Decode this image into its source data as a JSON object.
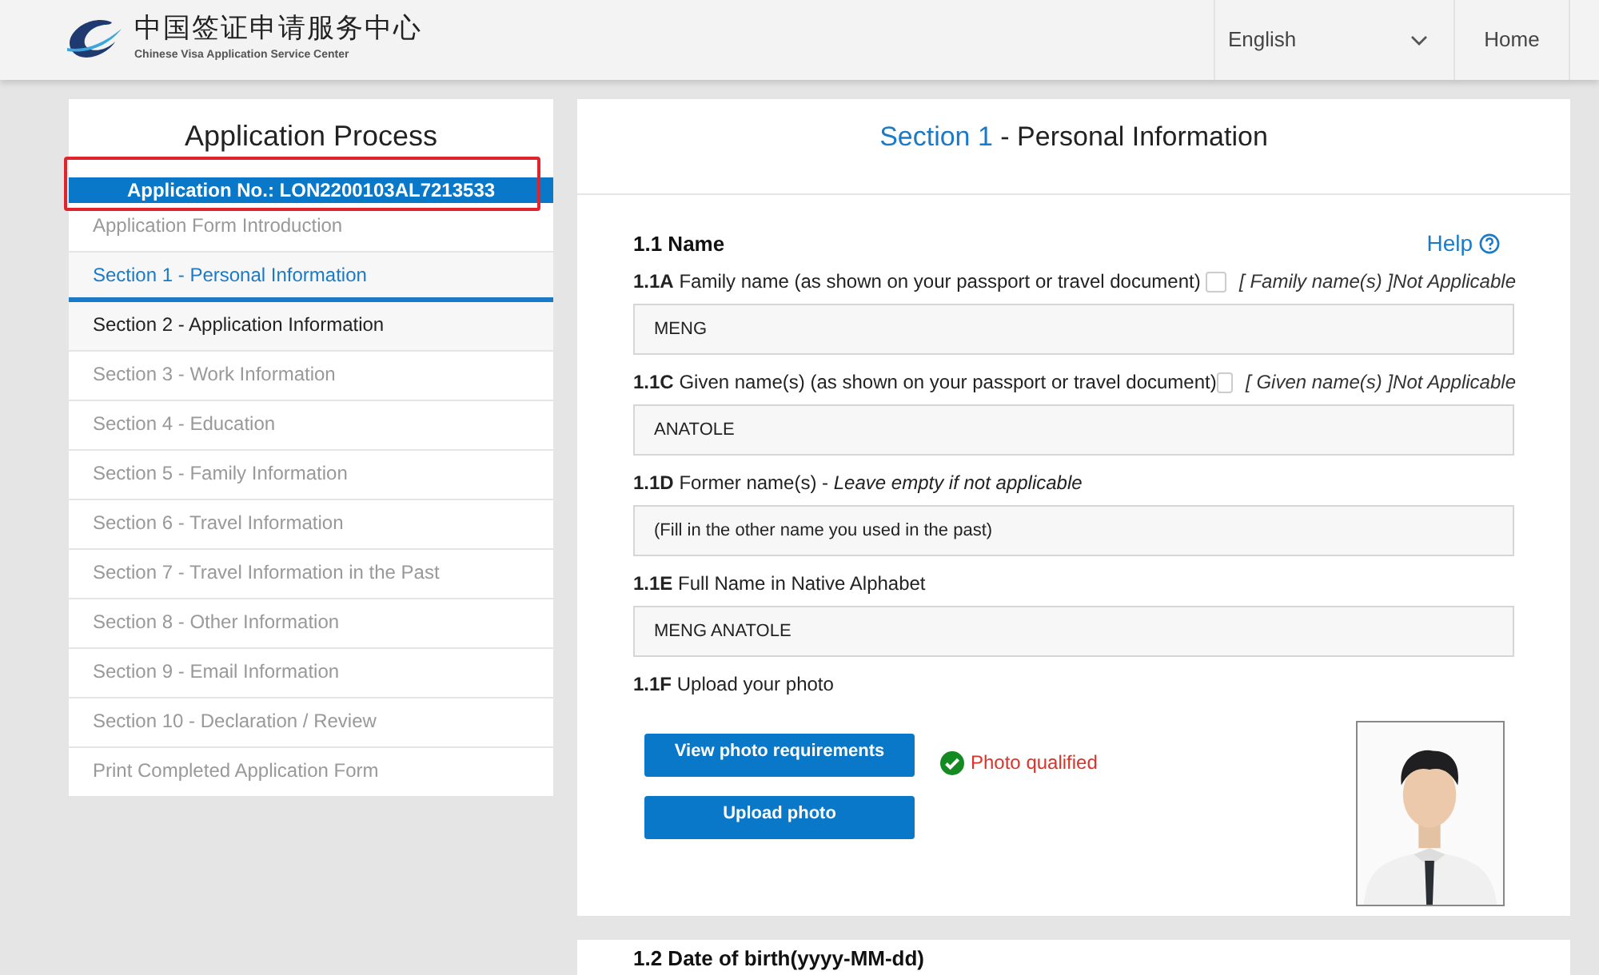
{
  "header": {
    "logo_title": "中国签证申请服务中心",
    "logo_subtitle": "Chinese Visa Application Service Center",
    "language": "English",
    "home": "Home"
  },
  "sidebar": {
    "title": "Application Process",
    "application_no": "Application No.: LON2200103AL7213533",
    "items": [
      {
        "label": "Application Form Introduction",
        "selected": false,
        "available": false
      },
      {
        "label": "Section 1 - Personal Information",
        "selected": true,
        "available": true
      },
      {
        "label": "Section 2 - Application Information",
        "selected": false,
        "available": true
      },
      {
        "label": "Section 3 - Work Information",
        "selected": false,
        "available": false
      },
      {
        "label": "Section 4 - Education",
        "selected": false,
        "available": false
      },
      {
        "label": "Section 5 - Family Information",
        "selected": false,
        "available": false
      },
      {
        "label": "Section 6 - Travel Information",
        "selected": false,
        "available": false
      },
      {
        "label": "Section 7 - Travel Information in the Past",
        "selected": false,
        "available": false
      },
      {
        "label": "Section 8 - Other Information",
        "selected": false,
        "available": false
      },
      {
        "label": "Section 9 - Email Information",
        "selected": false,
        "available": false
      },
      {
        "label": "Section 10 - Declaration / Review",
        "selected": false,
        "available": false
      },
      {
        "label": "Print Completed Application Form",
        "selected": false,
        "available": false
      }
    ]
  },
  "main": {
    "section_number": "Section 1",
    "section_title": " - Personal Information",
    "subsection": "1.1 Name",
    "help": "Help",
    "fields": [
      {
        "code": "1.1A",
        "label": "Family name (as shown on your passport or travel document)",
        "na_label": "[ Family name(s) ]Not Applicable",
        "na_checked": false,
        "value": "MENG"
      },
      {
        "code": "1.1C",
        "label": "Given name(s) (as shown on your passport or travel document)",
        "na_label": "[ Given name(s) ]Not Applicable",
        "na_checked": false,
        "value": "ANATOLE"
      },
      {
        "code": "1.1D",
        "label": "Former name(s) - *Leave empty if not applicable*",
        "placeholder": "(Fill in the other name you used in the past)"
      },
      {
        "code": "1.1E",
        "label": "Full Name in Native Alphabet",
        "value": "MENG ANATOLE"
      }
    ],
    "photo": {
      "code": "1.1F",
      "label": "Upload your photo",
      "buttons": [
        "View photo requirements",
        "Upload photo"
      ],
      "status": "Photo qualified",
      "qualified": true
    },
    "next_section": "1.2 Date of birth(yyyy-MM-dd)"
  }
}
